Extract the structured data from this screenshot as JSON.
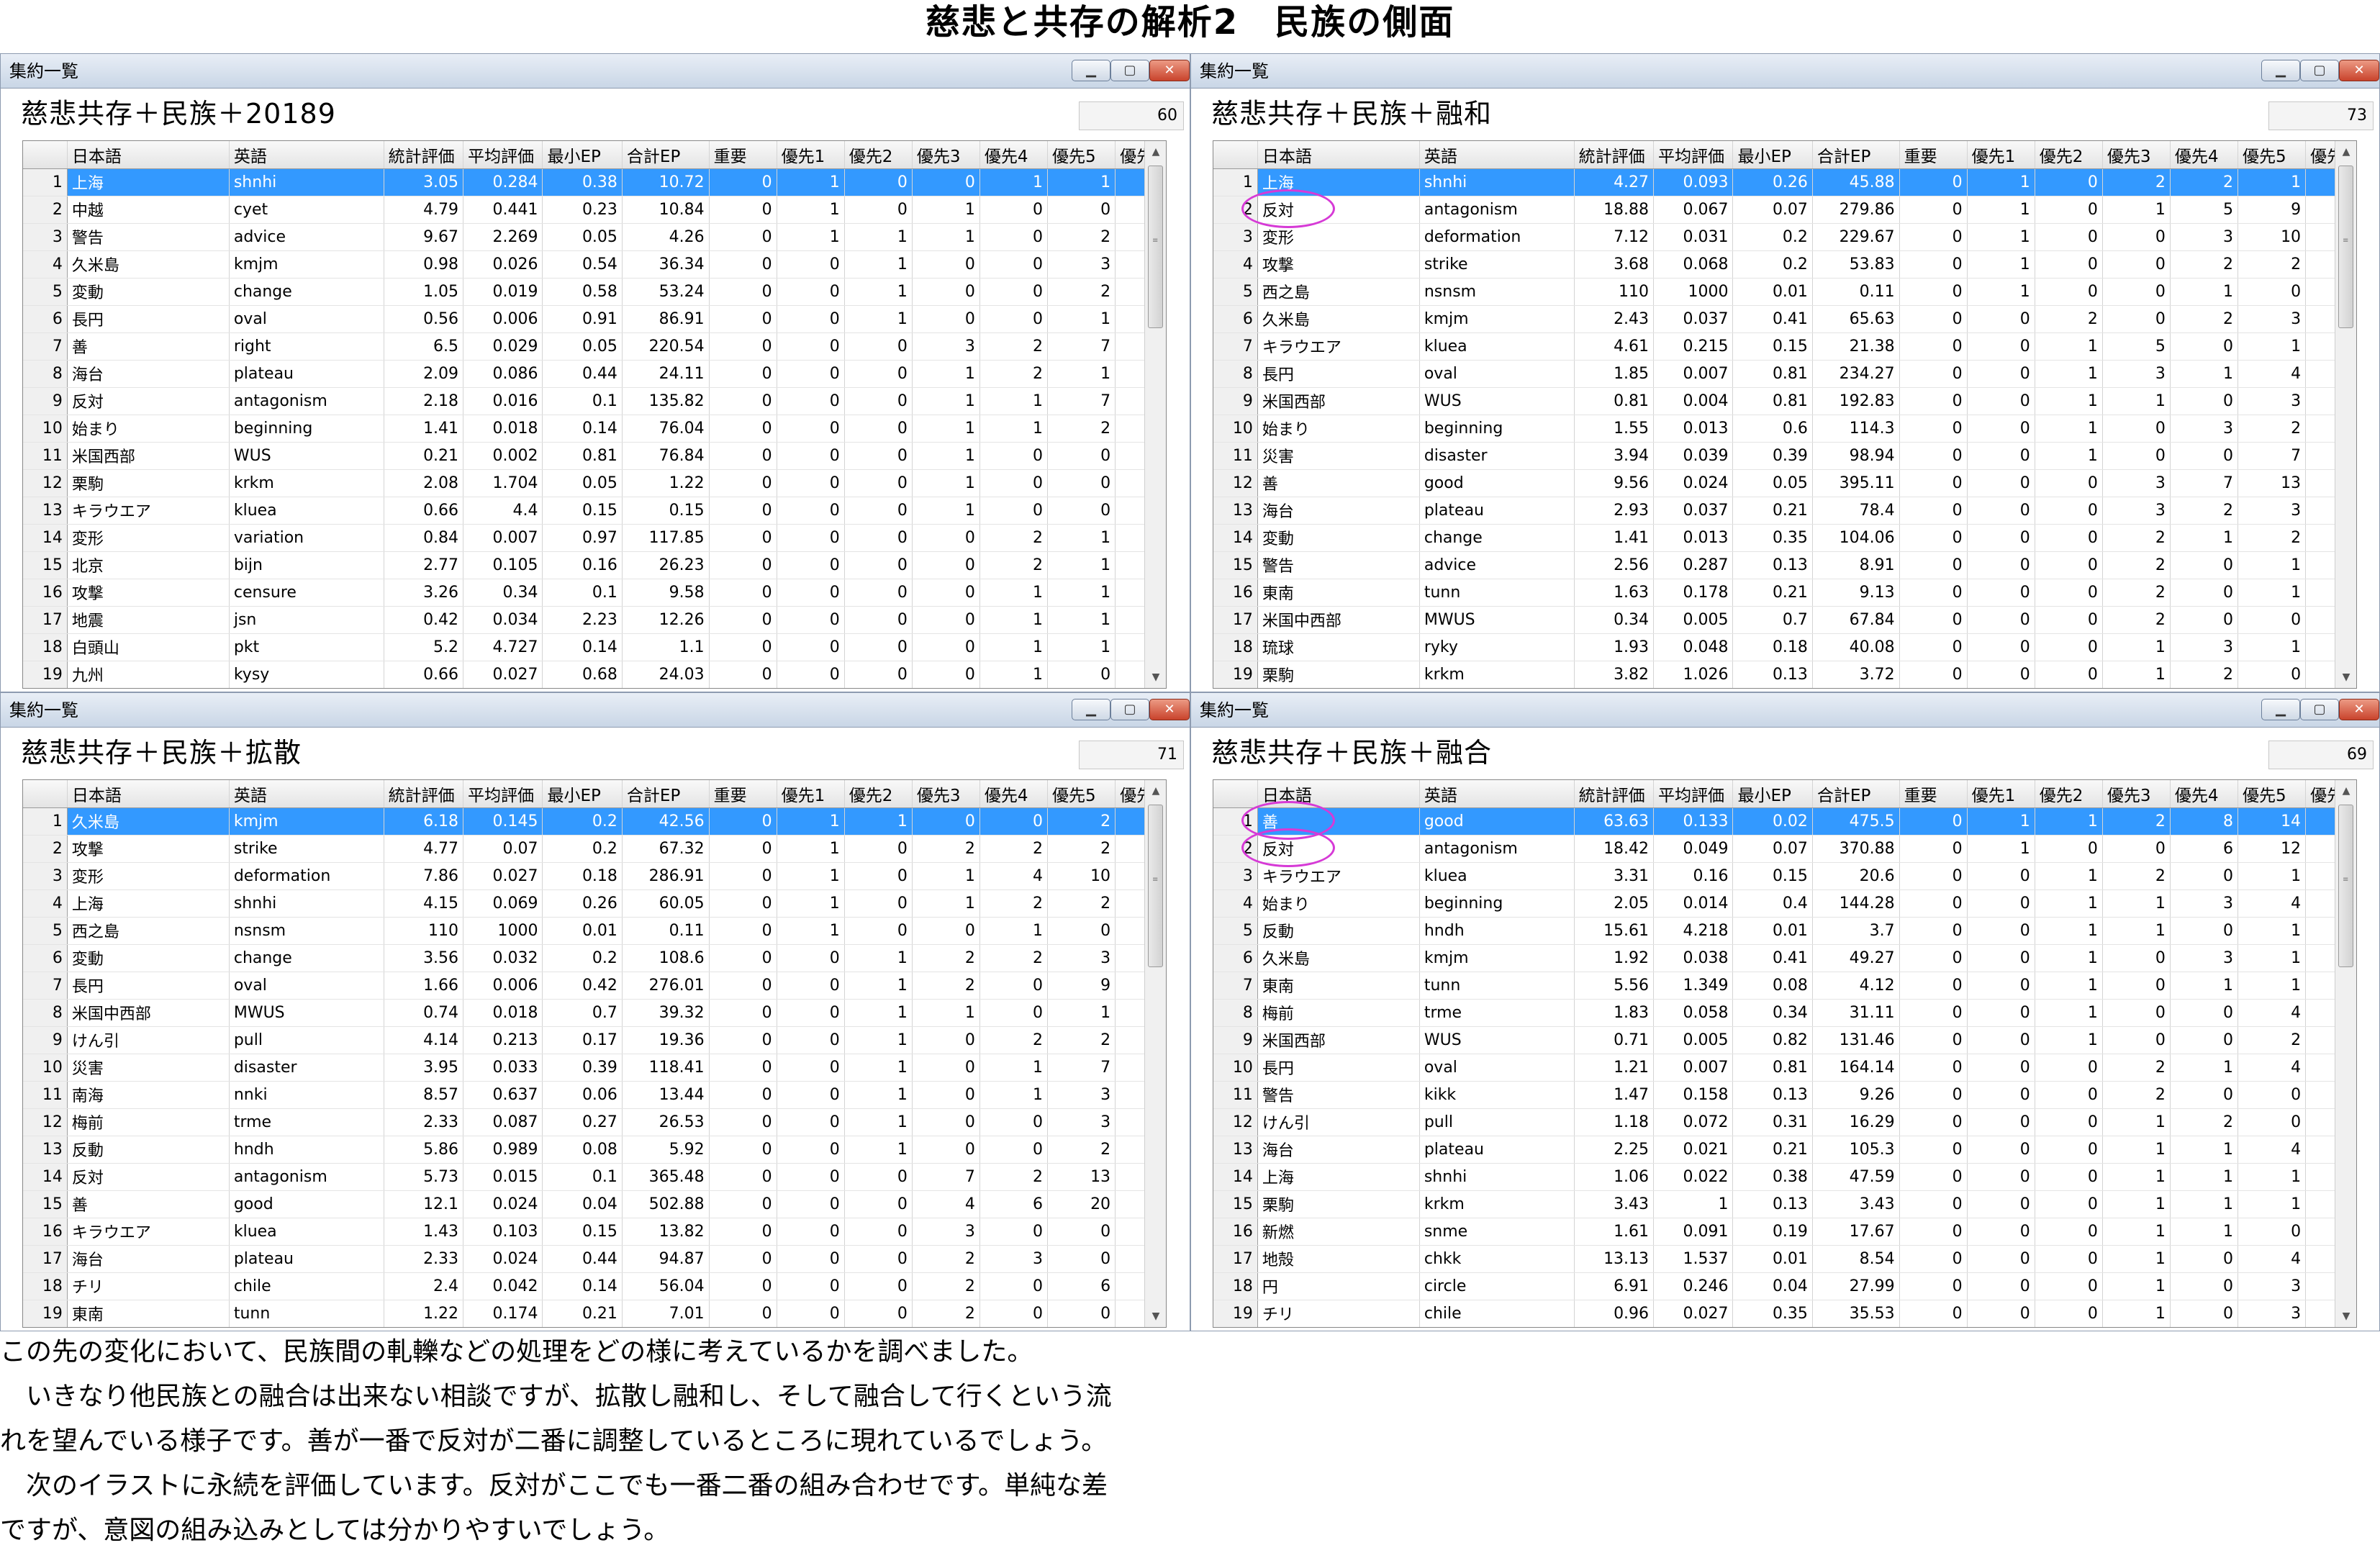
{
  "page": {
    "title": "慈悲と共存の解析2　民族の側面",
    "paragraphs": [
      "この先の変化において、民族間の軋轢などの処理をどの様に考えているかを調べました。",
      "　いきなり他民族との融合は出来ない相談ですが、拡散し融和し、そして融合して行くという流",
      "れを望んでいる様子です。善が一番で反対が二番に調整しているところに現れているでしょう。",
      "　次のイラストに永続を評価しています。反対がここでも一番二番の組み合わせです。単純な差",
      "ですが、意図の組み込みとしては分かりやすいでしょう。"
    ]
  },
  "columns": [
    "日本語",
    "英語",
    "統計評価",
    "平均評価",
    "最小EP",
    "合計EP",
    "重要",
    "優先1",
    "優先2",
    "優先3",
    "優先4",
    "優先5",
    "優先"
  ],
  "window_caption": "集約一覧",
  "window_buttons": {
    "minimize": "▁",
    "maximize": "▢",
    "close": "✕"
  },
  "scroll_arrows": {
    "up": "▲",
    "down": "▼"
  },
  "panels": [
    {
      "heading": "慈悲共存＋民族＋20189",
      "count": "60",
      "rows": [
        [
          "上海",
          "shnhi",
          "3.05",
          "0.284",
          "0.38",
          "10.72",
          "0",
          "1",
          "0",
          "0",
          "1",
          "1"
        ],
        [
          "中越",
          "cyet",
          "4.79",
          "0.441",
          "0.23",
          "10.84",
          "0",
          "1",
          "0",
          "1",
          "0",
          "0"
        ],
        [
          "警告",
          "advice",
          "9.67",
          "2.269",
          "0.05",
          "4.26",
          "0",
          "1",
          "1",
          "1",
          "0",
          "2"
        ],
        [
          "久米島",
          "kmjm",
          "0.98",
          "0.026",
          "0.54",
          "36.34",
          "0",
          "0",
          "1",
          "0",
          "0",
          "3"
        ],
        [
          "変動",
          "change",
          "1.05",
          "0.019",
          "0.58",
          "53.24",
          "0",
          "0",
          "1",
          "0",
          "0",
          "2"
        ],
        [
          "長円",
          "oval",
          "0.56",
          "0.006",
          "0.91",
          "86.91",
          "0",
          "0",
          "1",
          "0",
          "0",
          "1"
        ],
        [
          "善",
          "right",
          "6.5",
          "0.029",
          "0.05",
          "220.54",
          "0",
          "0",
          "0",
          "3",
          "2",
          "7"
        ],
        [
          "海台",
          "plateau",
          "2.09",
          "0.086",
          "0.44",
          "24.11",
          "0",
          "0",
          "0",
          "1",
          "2",
          "1"
        ],
        [
          "反対",
          "antagonism",
          "2.18",
          "0.016",
          "0.1",
          "135.82",
          "0",
          "0",
          "0",
          "1",
          "1",
          "7"
        ],
        [
          "始まり",
          "beginning",
          "1.41",
          "0.018",
          "0.14",
          "76.04",
          "0",
          "0",
          "0",
          "1",
          "1",
          "2"
        ],
        [
          "米国西部",
          "WUS",
          "0.21",
          "0.002",
          "0.81",
          "76.84",
          "0",
          "0",
          "0",
          "1",
          "0",
          "0"
        ],
        [
          "栗駒",
          "krkm",
          "2.08",
          "1.704",
          "0.05",
          "1.22",
          "0",
          "0",
          "0",
          "1",
          "0",
          "0"
        ],
        [
          "キラウエア",
          "kluea",
          "0.66",
          "4.4",
          "0.15",
          "0.15",
          "0",
          "0",
          "0",
          "1",
          "0",
          "0"
        ],
        [
          "変形",
          "variation",
          "0.84",
          "0.007",
          "0.97",
          "117.85",
          "0",
          "0",
          "0",
          "0",
          "2",
          "1"
        ],
        [
          "北京",
          "bijn",
          "2.77",
          "0.105",
          "0.16",
          "26.23",
          "0",
          "0",
          "0",
          "0",
          "2",
          "1"
        ],
        [
          "攻撃",
          "censure",
          "3.26",
          "0.34",
          "0.1",
          "9.58",
          "0",
          "0",
          "0",
          "0",
          "1",
          "1"
        ],
        [
          "地震",
          "jsn",
          "0.42",
          "0.034",
          "2.23",
          "12.26",
          "0",
          "0",
          "0",
          "0",
          "1",
          "1"
        ],
        [
          "白頭山",
          "pkt",
          "5.2",
          "4.727",
          "0.14",
          "1.1",
          "0",
          "0",
          "0",
          "0",
          "1",
          "1"
        ],
        [
          "九州",
          "kysy",
          "0.66",
          "0.027",
          "0.68",
          "24.03",
          "0",
          "0",
          "0",
          "0",
          "1",
          "0"
        ]
      ]
    },
    {
      "heading": "慈悲共存＋民族＋融和",
      "count": "73",
      "rows": [
        [
          "上海",
          "shnhi",
          "4.27",
          "0.093",
          "0.26",
          "45.88",
          "0",
          "1",
          "0",
          "2",
          "2",
          "1"
        ],
        [
          "反対",
          "antagonism",
          "18.88",
          "0.067",
          "0.07",
          "279.86",
          "0",
          "1",
          "0",
          "1",
          "5",
          "9"
        ],
        [
          "変形",
          "deformation",
          "7.12",
          "0.031",
          "0.2",
          "229.67",
          "0",
          "1",
          "0",
          "0",
          "3",
          "10"
        ],
        [
          "攻撃",
          "strike",
          "3.68",
          "0.068",
          "0.2",
          "53.83",
          "0",
          "1",
          "0",
          "0",
          "2",
          "2"
        ],
        [
          "西之島",
          "nsnsm",
          "110",
          "1000",
          "0.01",
          "0.11",
          "0",
          "1",
          "0",
          "0",
          "1",
          "0"
        ],
        [
          "久米島",
          "kmjm",
          "2.43",
          "0.037",
          "0.41",
          "65.63",
          "0",
          "0",
          "2",
          "0",
          "2",
          "3"
        ],
        [
          "キラウエア",
          "kluea",
          "4.61",
          "0.215",
          "0.15",
          "21.38",
          "0",
          "0",
          "1",
          "5",
          "0",
          "1"
        ],
        [
          "長円",
          "oval",
          "1.85",
          "0.007",
          "0.81",
          "234.27",
          "0",
          "0",
          "1",
          "3",
          "1",
          "4"
        ],
        [
          "米国西部",
          "WUS",
          "0.81",
          "0.004",
          "0.81",
          "192.83",
          "0",
          "0",
          "1",
          "1",
          "0",
          "3"
        ],
        [
          "始まり",
          "beginning",
          "1.55",
          "0.013",
          "0.6",
          "114.3",
          "0",
          "0",
          "1",
          "0",
          "3",
          "2"
        ],
        [
          "災害",
          "disaster",
          "3.94",
          "0.039",
          "0.39",
          "98.94",
          "0",
          "0",
          "1",
          "0",
          "0",
          "7"
        ],
        [
          "善",
          "good",
          "9.56",
          "0.024",
          "0.05",
          "395.11",
          "0",
          "0",
          "0",
          "3",
          "7",
          "13"
        ],
        [
          "海台",
          "plateau",
          "2.93",
          "0.037",
          "0.21",
          "78.4",
          "0",
          "0",
          "0",
          "3",
          "2",
          "3"
        ],
        [
          "変動",
          "change",
          "1.41",
          "0.013",
          "0.35",
          "104.06",
          "0",
          "0",
          "0",
          "2",
          "1",
          "2"
        ],
        [
          "警告",
          "advice",
          "2.56",
          "0.287",
          "0.13",
          "8.91",
          "0",
          "0",
          "0",
          "2",
          "0",
          "1"
        ],
        [
          "東南",
          "tunn",
          "1.63",
          "0.178",
          "0.21",
          "9.13",
          "0",
          "0",
          "0",
          "2",
          "0",
          "1"
        ],
        [
          "米国中西部",
          "MWUS",
          "0.34",
          "0.005",
          "0.7",
          "67.84",
          "0",
          "0",
          "0",
          "2",
          "0",
          "0"
        ],
        [
          "琉球",
          "ryky",
          "1.93",
          "0.048",
          "0.18",
          "40.08",
          "0",
          "0",
          "0",
          "1",
          "3",
          "1"
        ],
        [
          "栗駒",
          "krkm",
          "3.82",
          "1.026",
          "0.13",
          "3.72",
          "0",
          "0",
          "0",
          "1",
          "2",
          "0"
        ]
      ]
    },
    {
      "heading": "慈悲共存＋民族＋拡散",
      "count": "71",
      "rows": [
        [
          "久米島",
          "kmjm",
          "6.18",
          "0.145",
          "0.2",
          "42.56",
          "0",
          "1",
          "1",
          "0",
          "0",
          "2"
        ],
        [
          "攻撃",
          "strike",
          "4.77",
          "0.07",
          "0.2",
          "67.32",
          "0",
          "1",
          "0",
          "2",
          "2",
          "2"
        ],
        [
          "変形",
          "deformation",
          "7.86",
          "0.027",
          "0.18",
          "286.91",
          "0",
          "1",
          "0",
          "1",
          "4",
          "10"
        ],
        [
          "上海",
          "shnhi",
          "4.15",
          "0.069",
          "0.26",
          "60.05",
          "0",
          "1",
          "0",
          "1",
          "2",
          "2"
        ],
        [
          "西之島",
          "nsnsm",
          "110",
          "1000",
          "0.01",
          "0.11",
          "0",
          "1",
          "0",
          "0",
          "1",
          "0"
        ],
        [
          "変動",
          "change",
          "3.56",
          "0.032",
          "0.2",
          "108.6",
          "0",
          "0",
          "1",
          "2",
          "2",
          "3"
        ],
        [
          "長円",
          "oval",
          "1.66",
          "0.006",
          "0.42",
          "276.01",
          "0",
          "0",
          "1",
          "2",
          "0",
          "9"
        ],
        [
          "米国中西部",
          "MWUS",
          "0.74",
          "0.018",
          "0.7",
          "39.32",
          "0",
          "0",
          "1",
          "1",
          "0",
          "1"
        ],
        [
          "けん引",
          "pull",
          "4.14",
          "0.213",
          "0.17",
          "19.36",
          "0",
          "0",
          "1",
          "0",
          "2",
          "2"
        ],
        [
          "災害",
          "disaster",
          "3.95",
          "0.033",
          "0.39",
          "118.41",
          "0",
          "0",
          "1",
          "0",
          "1",
          "7"
        ],
        [
          "南海",
          "nnki",
          "8.57",
          "0.637",
          "0.06",
          "13.44",
          "0",
          "0",
          "1",
          "0",
          "1",
          "3"
        ],
        [
          "梅前",
          "trme",
          "2.33",
          "0.087",
          "0.27",
          "26.53",
          "0",
          "0",
          "1",
          "0",
          "0",
          "3"
        ],
        [
          "反動",
          "hndh",
          "5.86",
          "0.989",
          "0.08",
          "5.92",
          "0",
          "0",
          "1",
          "0",
          "0",
          "2"
        ],
        [
          "反対",
          "antagonism",
          "5.73",
          "0.015",
          "0.1",
          "365.48",
          "0",
          "0",
          "0",
          "7",
          "2",
          "13"
        ],
        [
          "善",
          "good",
          "12.1",
          "0.024",
          "0.04",
          "502.88",
          "0",
          "0",
          "0",
          "4",
          "6",
          "20"
        ],
        [
          "キラウエア",
          "kluea",
          "1.43",
          "0.103",
          "0.15",
          "13.82",
          "0",
          "0",
          "0",
          "3",
          "0",
          "0"
        ],
        [
          "海台",
          "plateau",
          "2.33",
          "0.024",
          "0.44",
          "94.87",
          "0",
          "0",
          "0",
          "2",
          "3",
          "0"
        ],
        [
          "チリ",
          "chile",
          "2.4",
          "0.042",
          "0.14",
          "56.04",
          "0",
          "0",
          "0",
          "2",
          "0",
          "6"
        ],
        [
          "東南",
          "tunn",
          "1.22",
          "0.174",
          "0.21",
          "7.01",
          "0",
          "0",
          "0",
          "2",
          "0",
          "0"
        ]
      ]
    },
    {
      "heading": "慈悲共存＋民族＋融合",
      "count": "69",
      "rows": [
        [
          "善",
          "good",
          "63.63",
          "0.133",
          "0.02",
          "475.5",
          "0",
          "1",
          "1",
          "2",
          "8",
          "14"
        ],
        [
          "反対",
          "antagonism",
          "18.42",
          "0.049",
          "0.07",
          "370.88",
          "0",
          "1",
          "0",
          "0",
          "6",
          "12"
        ],
        [
          "キラウエア",
          "kluea",
          "3.31",
          "0.16",
          "0.15",
          "20.6",
          "0",
          "0",
          "1",
          "2",
          "0",
          "1"
        ],
        [
          "始まり",
          "beginning",
          "2.05",
          "0.014",
          "0.4",
          "144.28",
          "0",
          "0",
          "1",
          "1",
          "3",
          "4"
        ],
        [
          "反動",
          "hndh",
          "15.61",
          "4.218",
          "0.01",
          "3.7",
          "0",
          "0",
          "1",
          "1",
          "0",
          "1"
        ],
        [
          "久米島",
          "kmjm",
          "1.92",
          "0.038",
          "0.41",
          "49.27",
          "0",
          "0",
          "1",
          "0",
          "3",
          "1"
        ],
        [
          "東南",
          "tunn",
          "5.56",
          "1.349",
          "0.08",
          "4.12",
          "0",
          "0",
          "1",
          "0",
          "1",
          "1"
        ],
        [
          "梅前",
          "trme",
          "1.83",
          "0.058",
          "0.34",
          "31.11",
          "0",
          "0",
          "1",
          "0",
          "0",
          "4"
        ],
        [
          "米国西部",
          "WUS",
          "0.71",
          "0.005",
          "0.82",
          "131.46",
          "0",
          "0",
          "1",
          "0",
          "0",
          "2"
        ],
        [
          "長円",
          "oval",
          "1.21",
          "0.007",
          "0.81",
          "164.14",
          "0",
          "0",
          "0",
          "2",
          "1",
          "4"
        ],
        [
          "警告",
          "kikk",
          "1.47",
          "0.158",
          "0.13",
          "9.26",
          "0",
          "0",
          "0",
          "2",
          "0",
          "0"
        ],
        [
          "けん引",
          "pull",
          "1.18",
          "0.072",
          "0.31",
          "16.29",
          "0",
          "0",
          "0",
          "1",
          "2",
          "0"
        ],
        [
          "海台",
          "plateau",
          "2.25",
          "0.021",
          "0.21",
          "105.3",
          "0",
          "0",
          "0",
          "1",
          "1",
          "4"
        ],
        [
          "上海",
          "shnhi",
          "1.06",
          "0.022",
          "0.38",
          "47.59",
          "0",
          "0",
          "0",
          "1",
          "1",
          "1"
        ],
        [
          "栗駒",
          "krkm",
          "3.43",
          "1",
          "0.13",
          "3.43",
          "0",
          "0",
          "0",
          "1",
          "1",
          "1"
        ],
        [
          "新燃",
          "snme",
          "1.61",
          "0.091",
          "0.19",
          "17.67",
          "0",
          "0",
          "0",
          "1",
          "1",
          "0"
        ],
        [
          "地殻",
          "chkk",
          "13.13",
          "1.537",
          "0.01",
          "8.54",
          "0",
          "0",
          "0",
          "1",
          "0",
          "4"
        ],
        [
          "円",
          "circle",
          "6.91",
          "0.246",
          "0.04",
          "27.99",
          "0",
          "0",
          "0",
          "1",
          "0",
          "3"
        ],
        [
          "チリ",
          "chile",
          "0.96",
          "0.027",
          "0.35",
          "35.53",
          "0",
          "0",
          "0",
          "1",
          "0",
          "3"
        ]
      ]
    }
  ]
}
